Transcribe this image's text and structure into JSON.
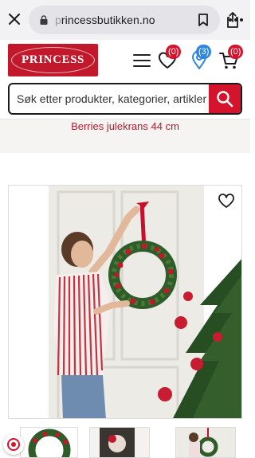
{
  "browser": {
    "url_prefix": "p",
    "url_main": "rincessbutikken.no",
    "icons": [
      "close-icon",
      "lock-icon",
      "bookmark-icon",
      "share-icon",
      "more-icon"
    ]
  },
  "header": {
    "logo_text": "PRINCESS",
    "favorites_count": "(0)",
    "stores_count": "(3)",
    "cart_count": "(0)",
    "search_placeholder": "Søk etter produkter, kategorier, artikler",
    "colors": {
      "brand": "#d3142c",
      "badge_blue": "#2e86de"
    }
  },
  "product": {
    "title": "Berries julekrans 44 cm",
    "image_alt": "Woman hanging a red berries wreath on a white door next to a decorated christmas tree"
  },
  "thumbnails": [
    "wreath-thumbnail",
    "decor-thumbnail",
    "woman-wreath-thumbnail"
  ]
}
